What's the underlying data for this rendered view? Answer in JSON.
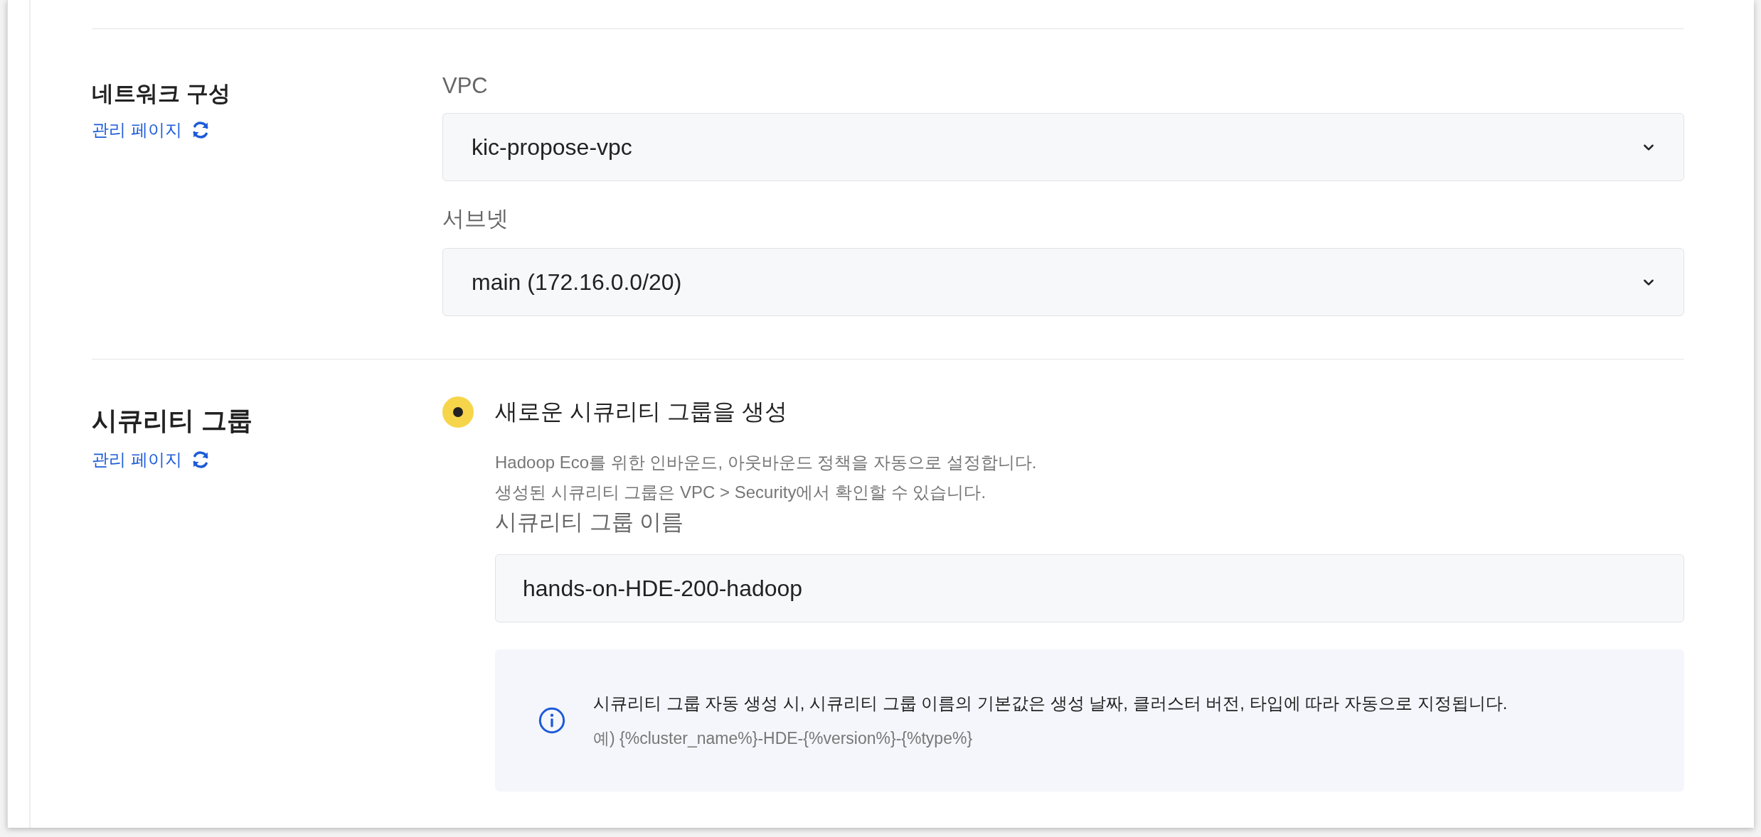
{
  "sections": [
    {
      "kind": "selects",
      "title": "네트워크 구성",
      "link": "관리 페이지",
      "fields": [
        {
          "label": "VPC",
          "value": "kic-propose-vpc"
        },
        {
          "label": "서브넷",
          "value": "main (172.16.0.0/20)"
        }
      ]
    },
    {
      "kind": "radio",
      "title": "시큐리티 그룹",
      "link": "관리 페이지",
      "options": [
        {
          "label": "새로운 시큐리티 그룹을 생성",
          "selected": true,
          "description": [
            "Hadoop Eco를 위한 인바운드, 아웃바운드 정책을 자동으로 설정합니다.",
            "생성된 시큐리티 그룹은 VPC > Security에서 확인할 수 있습니다."
          ],
          "name_label": "시큐리티 그룹 이름",
          "name_value": "hands-on-HDE-200-hadoop",
          "info": {
            "text": "시큐리티 그룹 자동 생성 시, 시큐리티 그룹 이름의 기본값은 생성 날짜, 클러스터 버전, 타입에 따라 자동으로 지정됩니다.",
            "example": "예) {%cluster_name%}-HDE-{%version%}-{%type%}"
          }
        }
      ]
    }
  ]
}
